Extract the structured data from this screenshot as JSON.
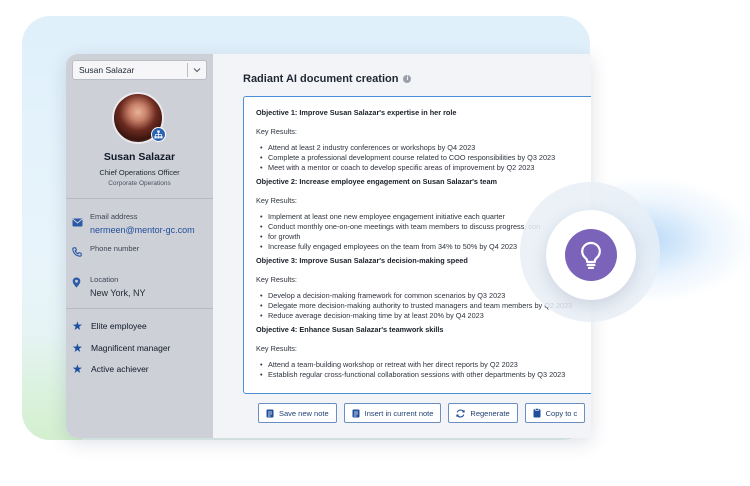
{
  "sidebar": {
    "user_select": {
      "value": "Susan Salazar"
    },
    "profile": {
      "name": "Susan Salazar",
      "title": "Chief Operations Officer",
      "department": "Corporate Operations"
    },
    "contact": {
      "email_label": "Email address",
      "email_value": "nermeen@mentor-gc.com",
      "phone_label": "Phone number",
      "location_label": "Location",
      "location_value": "New York, NY"
    },
    "achievements": [
      "Elite employee",
      "Magnificent manager",
      "Active achiever"
    ]
  },
  "main": {
    "title": "Radiant AI document creation",
    "document": {
      "key_results_label": "Key Results:",
      "objectives": [
        {
          "title": "Objective 1: Improve Susan Salazar's expertise in her role",
          "results": [
            "Attend at least 2 industry conferences or workshops by Q4 2023",
            "Complete a professional development course related to COO responsibilities by Q3 2023",
            "Meet with a mentor or coach to develop specific areas of improvement by Q2 2023"
          ]
        },
        {
          "title": "Objective 2: Increase employee engagement on Susan Salazar's team",
          "results": [
            "Implement at least one new employee engagement initiative each quarter",
            "Conduct monthly one-on-one meetings with team members to discuss progress, con",
            "for growth",
            "Increase fully engaged employees on the team from 34% to 50% by Q4 2023"
          ]
        },
        {
          "title": "Objective 3: Improve Susan Salazar's decision-making speed",
          "results": [
            "Develop a decision-making framework for common scenarios by Q3 2023",
            "Delegate more decision-making authority to trusted managers and team members by Q2 2023",
            "Reduce average decision-making time by at least 20% by Q4 2023"
          ]
        },
        {
          "title": "Objective 4: Enhance Susan Salazar's teamwork skills",
          "results": [
            "Attend a team-building workshop or retreat with her direct reports by Q2 2023",
            "Establish regular cross-functional collaboration sessions with other departments by Q3 2023"
          ]
        }
      ]
    },
    "actions": {
      "save_label": "Save new note",
      "insert_label": "Insert in current note",
      "regenerate_label": "Regenerate",
      "copy_label": "Copy to c"
    }
  },
  "colors": {
    "accent_blue": "#1d4fa0",
    "doc_border": "#4b8fd6",
    "bulb_purple": "#7a63b9",
    "sidebar_bg": "#cdd0d7"
  }
}
